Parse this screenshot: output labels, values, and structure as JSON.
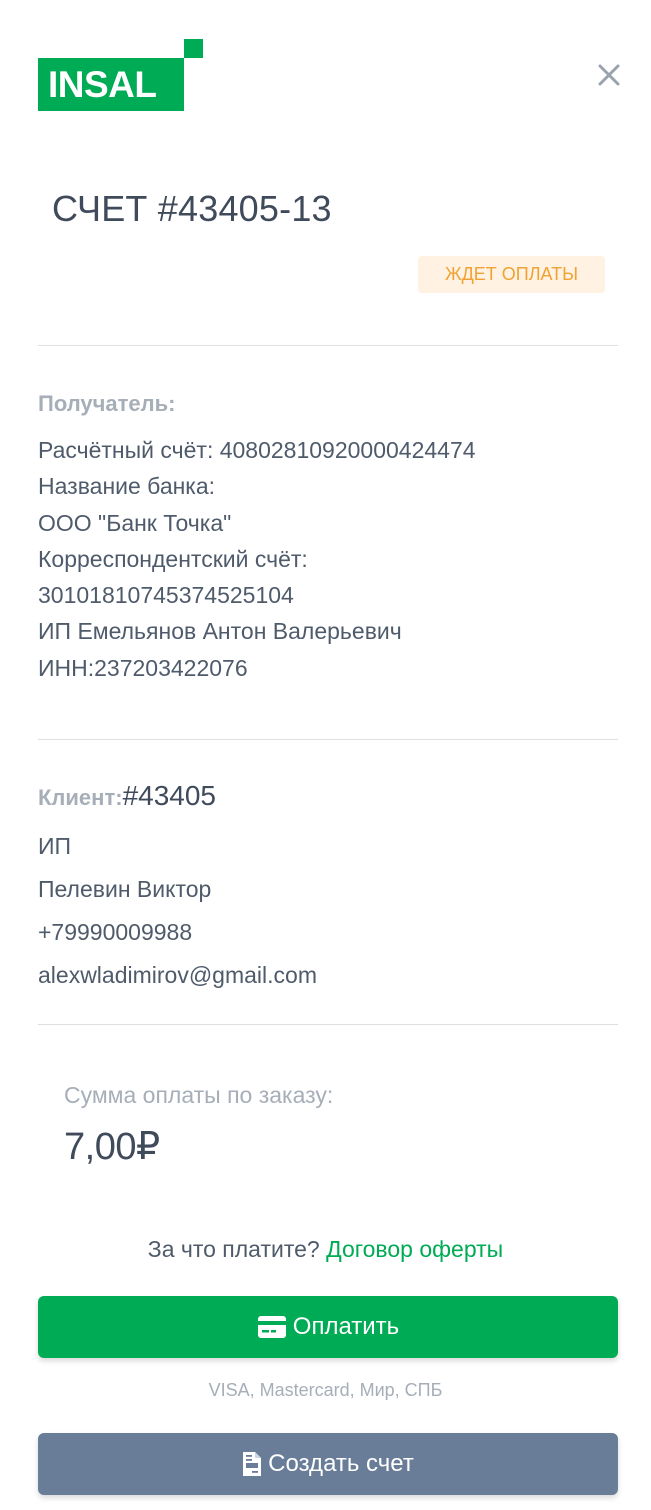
{
  "logo": {
    "text": "INSAL"
  },
  "icons": {
    "close": "close-icon",
    "card": "credit-card-icon",
    "invoice": "file-invoice-icon"
  },
  "colors": {
    "brand": "#00ab55",
    "badge_text": "#f0a232",
    "badge_bg": "#fff2e3",
    "secondary_button": "#697c98"
  },
  "invoice": {
    "title": "СЧЕТ #43405-13",
    "status": "ЖДЕТ ОПЛАТЫ"
  },
  "recipient": {
    "label": "Получатель:",
    "lines": [
      "Расчётный счёт: 40802810920000424474",
      "Название банка:",
      "ООО \"Банк Точка\"",
      "Корреспондентский счёт:",
      "30101810745374525104",
      "ИП Емельянов Антон Валерьевич",
      "ИНН:237203422076"
    ]
  },
  "client": {
    "label": "Клиент:",
    "number": "#43405",
    "lines": [
      "ИП",
      "Пелевин Виктор",
      "+79990009988",
      "alexwladimirov@gmail.com"
    ]
  },
  "payment": {
    "sum_label": "Сумма оплаты по заказу:",
    "sum_value": "7,00₽",
    "offer_question": "За что платите?",
    "offer_link": "Договор оферты",
    "pay_label": "Оплатить",
    "methods": "VISA, Mastercard, Мир, СПБ",
    "create_label": "Создать счет"
  }
}
